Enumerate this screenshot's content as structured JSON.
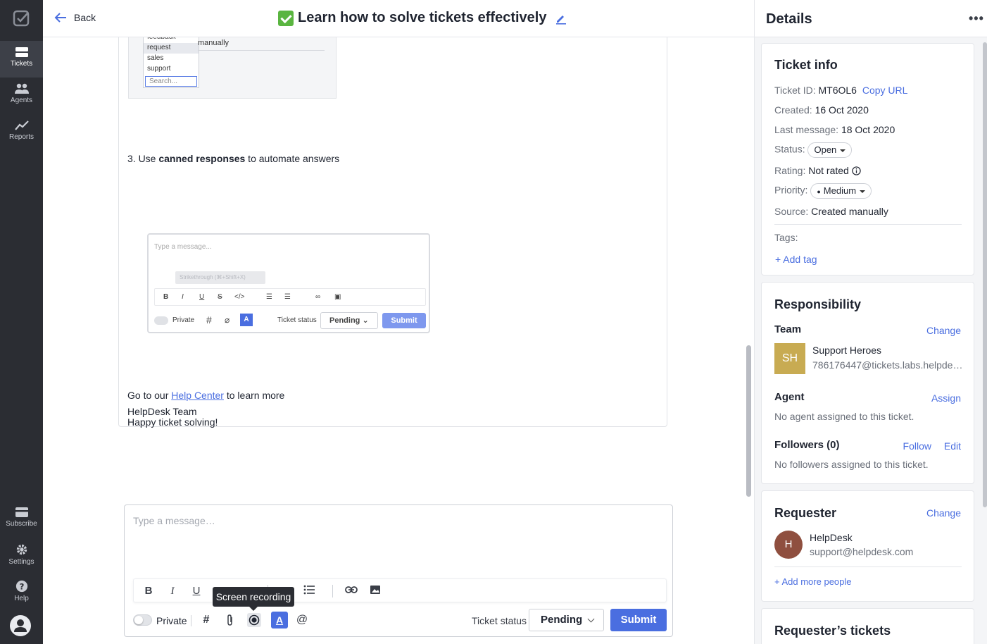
{
  "nav": {
    "items": [
      {
        "label": "Tickets"
      },
      {
        "label": "Agents"
      },
      {
        "label": "Reports"
      },
      {
        "label": "Subscribe"
      },
      {
        "label": "Settings"
      },
      {
        "label": "Help"
      }
    ]
  },
  "header": {
    "back_label": "Back",
    "title": "Learn how to solve tickets effectively"
  },
  "message": {
    "dropdown_items": [
      "feedback",
      "request",
      "sales",
      "support"
    ],
    "dropdown_search": "Search...",
    "dropdown_side": "manually",
    "step3_prefix": "3. Use ",
    "step3_bold": "canned responses",
    "step3_suffix": " to automate answers",
    "embed": {
      "placeholder": "Type a message...",
      "tooltip": "Strikethrough (⌘+Shift+X)",
      "private": "Private",
      "ticket_status": "Ticket status",
      "status_value": "Pending",
      "submit": "Submit"
    },
    "goto_prefix": "Go to our ",
    "goto_link": "Help Center",
    "goto_suffix": " to learn more",
    "happy": "Happy ticket solving!",
    "signature": "HelpDesk Team"
  },
  "composer": {
    "placeholder": "Type a message…",
    "private_label": "Private",
    "status_label": "Ticket status",
    "status_value": "Pending",
    "submit_label": "Submit",
    "tooltip": "Screen recording"
  },
  "details": {
    "title": "Details",
    "ticket_info": {
      "heading": "Ticket info",
      "id_key": "Ticket ID:",
      "id_value": "MT6OL6",
      "copy_url": "Copy URL",
      "created_key": "Created:",
      "created_value": "16 Oct 2020",
      "last_key": "Last message:",
      "last_value": "18 Oct 2020",
      "status_key": "Status:",
      "status_value": "Open",
      "rating_key": "Rating:",
      "rating_value": "Not rated",
      "priority_key": "Priority:",
      "priority_value": "Medium",
      "source_key": "Source:",
      "source_value": "Created manually",
      "tags_key": "Tags:",
      "add_tag": "+ Add tag"
    },
    "responsibility": {
      "heading": "Responsibility",
      "team_label": "Team",
      "team_change": "Change",
      "team_initials": "SH",
      "team_name": "Support Heroes",
      "team_email": "786176447@tickets.labs.helpde…",
      "agent_label": "Agent",
      "agent_assign": "Assign",
      "agent_empty": "No agent assigned to this ticket.",
      "followers_label": "Followers (0)",
      "follow": "Follow",
      "edit": "Edit",
      "followers_empty": "No followers assigned to this ticket."
    },
    "requester": {
      "heading": "Requester",
      "change": "Change",
      "initial": "H",
      "name": "HelpDesk",
      "email": "support@helpdesk.com",
      "add_people": "+ Add more people"
    },
    "requester_tickets": {
      "heading": "Requester’s tickets"
    }
  },
  "colors": {
    "accent": "#4a6ee0",
    "nav_bg": "#2b2d33",
    "team_avatar": "#c8ab52",
    "requester_avatar": "#8f4f3f"
  }
}
